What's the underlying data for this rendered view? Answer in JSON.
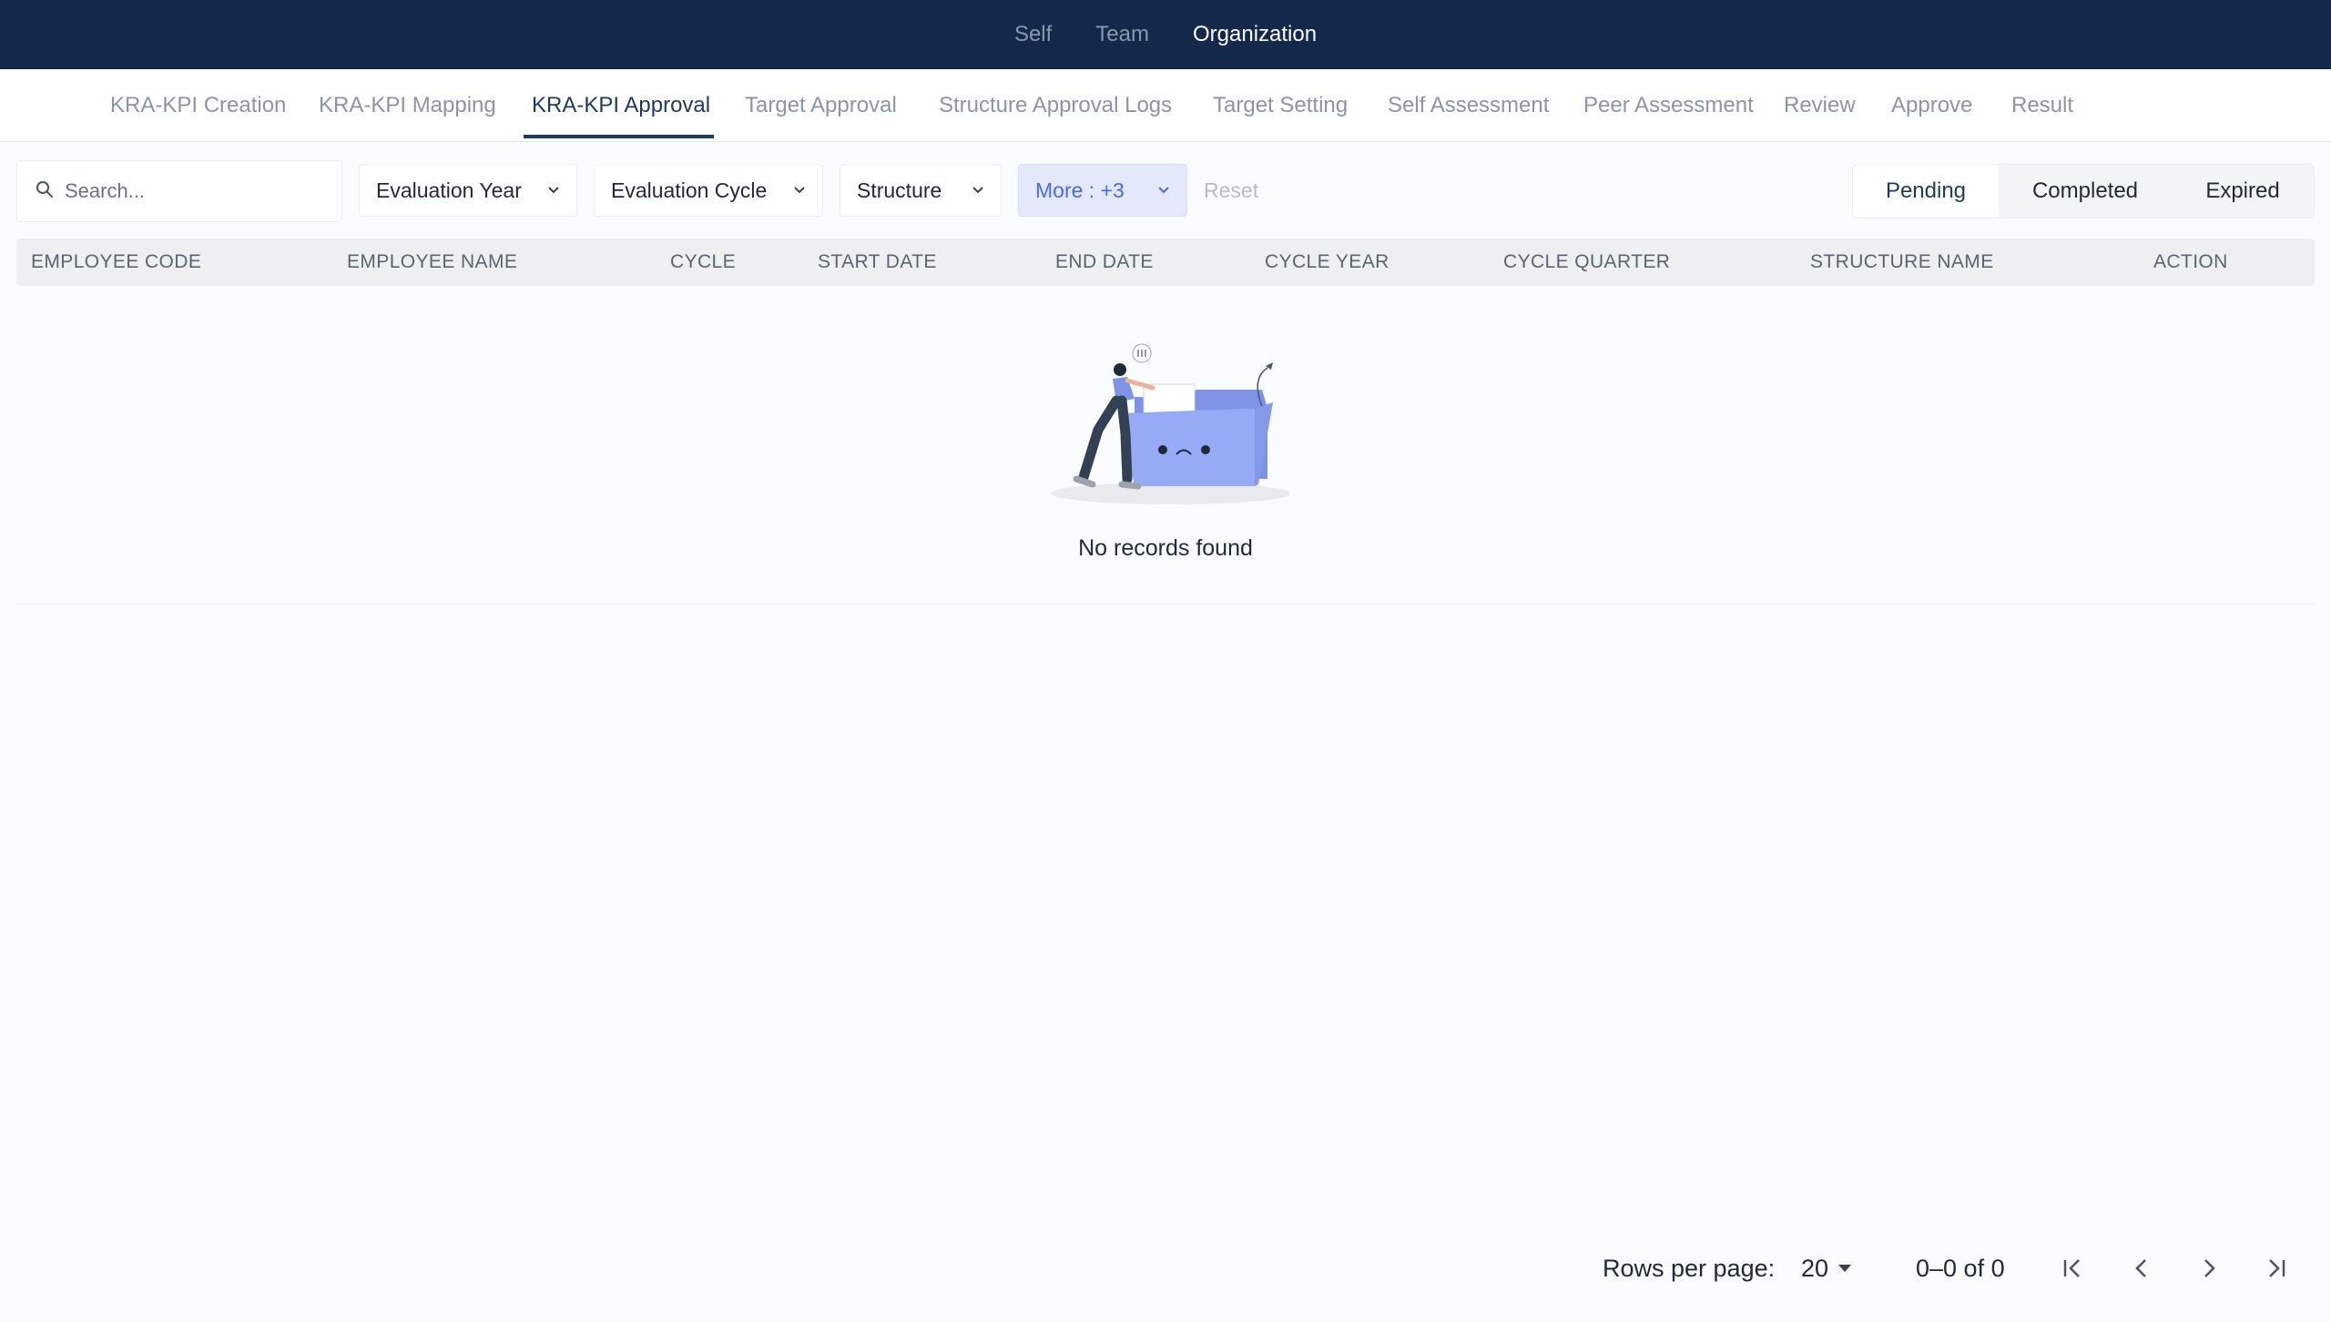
{
  "topbar": {
    "tabs": [
      {
        "label": "Self",
        "active": false
      },
      {
        "label": "Team",
        "active": false
      },
      {
        "label": "Organization",
        "active": true
      }
    ]
  },
  "subnav": {
    "items": [
      {
        "label": "KRA-KPI Creation"
      },
      {
        "label": "KRA-KPI Mapping"
      },
      {
        "label": "KRA-KPI Approval",
        "active": true
      },
      {
        "label": "Target Approval"
      },
      {
        "label": "Structure Approval Logs"
      },
      {
        "label": "Target Setting"
      },
      {
        "label": "Self Assessment"
      },
      {
        "label": "Peer Assessment"
      },
      {
        "label": "Review"
      },
      {
        "label": "Approve"
      },
      {
        "label": "Result"
      }
    ]
  },
  "filters": {
    "search_placeholder": "Search...",
    "evaluation_year": "Evaluation Year",
    "evaluation_cycle": "Evaluation Cycle",
    "structure": "Structure",
    "more": "More : +3",
    "reset": "Reset"
  },
  "status_tabs": [
    {
      "label": "Pending",
      "active": true
    },
    {
      "label": "Completed"
    },
    {
      "label": "Expired"
    }
  ],
  "table": {
    "columns": [
      "EMPLOYEE CODE",
      "EMPLOYEE NAME",
      "CYCLE",
      "START DATE",
      "END DATE",
      "CYCLE YEAR",
      "CYCLE QUARTER",
      "STRUCTURE NAME",
      "ACTION"
    ],
    "rows": [],
    "empty_message": "No records found"
  },
  "pagination": {
    "rows_per_page_label": "Rows per page:",
    "rows_per_page_value": "20",
    "range_text": "0–0 of 0"
  },
  "colors": {
    "topbar_bg": "#14284b",
    "active_accent": "#1e3a5f",
    "more_filter_bg": "#e3e9fb",
    "more_filter_text": "#4a6ae6",
    "illustration_folder": "#96aaf5"
  }
}
